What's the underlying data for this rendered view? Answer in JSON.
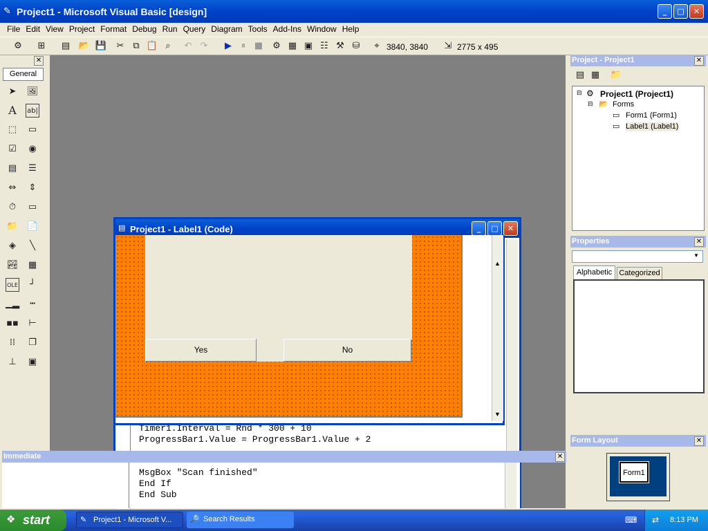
{
  "window": {
    "title": "Project1 - Microsoft Visual Basic [design]"
  },
  "menu": [
    "File",
    "Edit",
    "View",
    "Project",
    "Format",
    "Debug",
    "Run",
    "Query",
    "Diagram",
    "Tools",
    "Add-Ins",
    "Window",
    "Help"
  ],
  "toolbar": {
    "position": "3840, 3840",
    "size": "2775 x 495"
  },
  "toolbox": {
    "tab": "General"
  },
  "code_window": {
    "title": "Project1 - Label1 (Code)",
    "lines": [
      "Timer1.Interval = Rnd * 300 + 10",
      "ProgressBar1.Value = ProgressBar1.Value + 2",
      "MsgBox \"Scan finished\"",
      "End If",
      "End Sub"
    ]
  },
  "form": {
    "yes": "Yes",
    "no": "No"
  },
  "immediate": {
    "title": "Immediate"
  },
  "project": {
    "title": "Project - Project1",
    "root": "Project1 (Project1)",
    "forms": "Forms",
    "form1": "Form1 (Form1)",
    "label1": "Label1 (Label1)"
  },
  "properties": {
    "title": "Properties",
    "tab_alpha": "Alphabetic",
    "tab_cat": "Categorized"
  },
  "form_layout": {
    "title": "Form Layout",
    "form_label": "Form1"
  },
  "taskbar": {
    "start": "start",
    "task1": "Project1 - Microsoft V...",
    "task2": "Search Results",
    "clock": "8:13 PM"
  },
  "colors": {
    "form_bg": "#ff7f00",
    "titlebar": "#0042c8",
    "mdi_bg": "#808080"
  }
}
